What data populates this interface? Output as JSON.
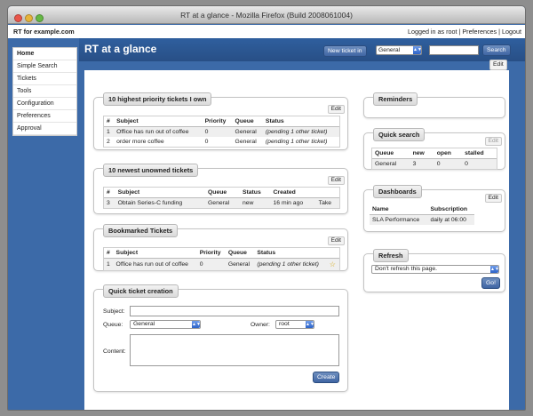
{
  "window": {
    "title": "RT at a glance - Mozilla Firefox (Build 2008061004)"
  },
  "topbar": {
    "site": "RT for example.com",
    "logged_in": "Logged in as root",
    "preferences": "Preferences",
    "logout": "Logout",
    "sep": "|"
  },
  "header": {
    "title": "RT at a glance",
    "new_ticket": "New ticket in",
    "queue": "General",
    "search_button": "Search"
  },
  "nav": {
    "items": [
      "Home",
      "Simple Search",
      "Tickets",
      "Tools",
      "Configuration",
      "Preferences",
      "Approval"
    ]
  },
  "page_edit": "Edit",
  "priority": {
    "title": "10 highest priority tickets I own",
    "edit": "Edit",
    "columns": [
      "#",
      "Subject",
      "Priority",
      "Queue",
      "Status"
    ],
    "rows": [
      [
        "1",
        "Office has run out of coffee",
        "0",
        "General",
        "(pending 1 other ticket)"
      ],
      [
        "2",
        "order more coffee",
        "0",
        "General",
        "(pending 1 other ticket)"
      ]
    ]
  },
  "unowned": {
    "title": "10 newest unowned tickets",
    "edit": "Edit",
    "columns": [
      "#",
      "Subject",
      "Queue",
      "Status",
      "Created",
      ""
    ],
    "rows": [
      [
        "3",
        "Obtain Series-C funding",
        "General",
        "new",
        "16 min ago",
        "Take"
      ]
    ]
  },
  "bookmarked": {
    "title": "Bookmarked Tickets",
    "edit": "Edit",
    "columns": [
      "#",
      "Subject",
      "Priority",
      "Queue",
      "Status"
    ],
    "rows": [
      [
        "1",
        "Office has run out of coffee",
        "0",
        "General",
        "(pending 1 other ticket)"
      ]
    ]
  },
  "quick_create": {
    "title": "Quick ticket creation",
    "subject_label": "Subject:",
    "queue_label": "Queue:",
    "queue_value": "General",
    "owner_label": "Owner:",
    "owner_value": "root",
    "content_label": "Content:",
    "create": "Create"
  },
  "reminders": {
    "title": "Reminders"
  },
  "quick_search": {
    "title": "Quick search",
    "edit": "Edit",
    "columns": [
      "Queue",
      "new",
      "open",
      "stalled"
    ],
    "rows": [
      [
        "General",
        "3",
        "0",
        "0"
      ]
    ]
  },
  "dashboards": {
    "title": "Dashboards",
    "edit": "Edit",
    "columns": [
      "Name",
      "Subscription"
    ],
    "rows": [
      [
        "SLA Performance",
        "daily at 06:00"
      ]
    ]
  },
  "refresh": {
    "title": "Refresh",
    "option": "Don't refresh this page.",
    "go": "Go!"
  },
  "colors": {
    "header": "#2f5f9e",
    "page_bg": "#3c6aa8",
    "button": "#3f65a3"
  }
}
